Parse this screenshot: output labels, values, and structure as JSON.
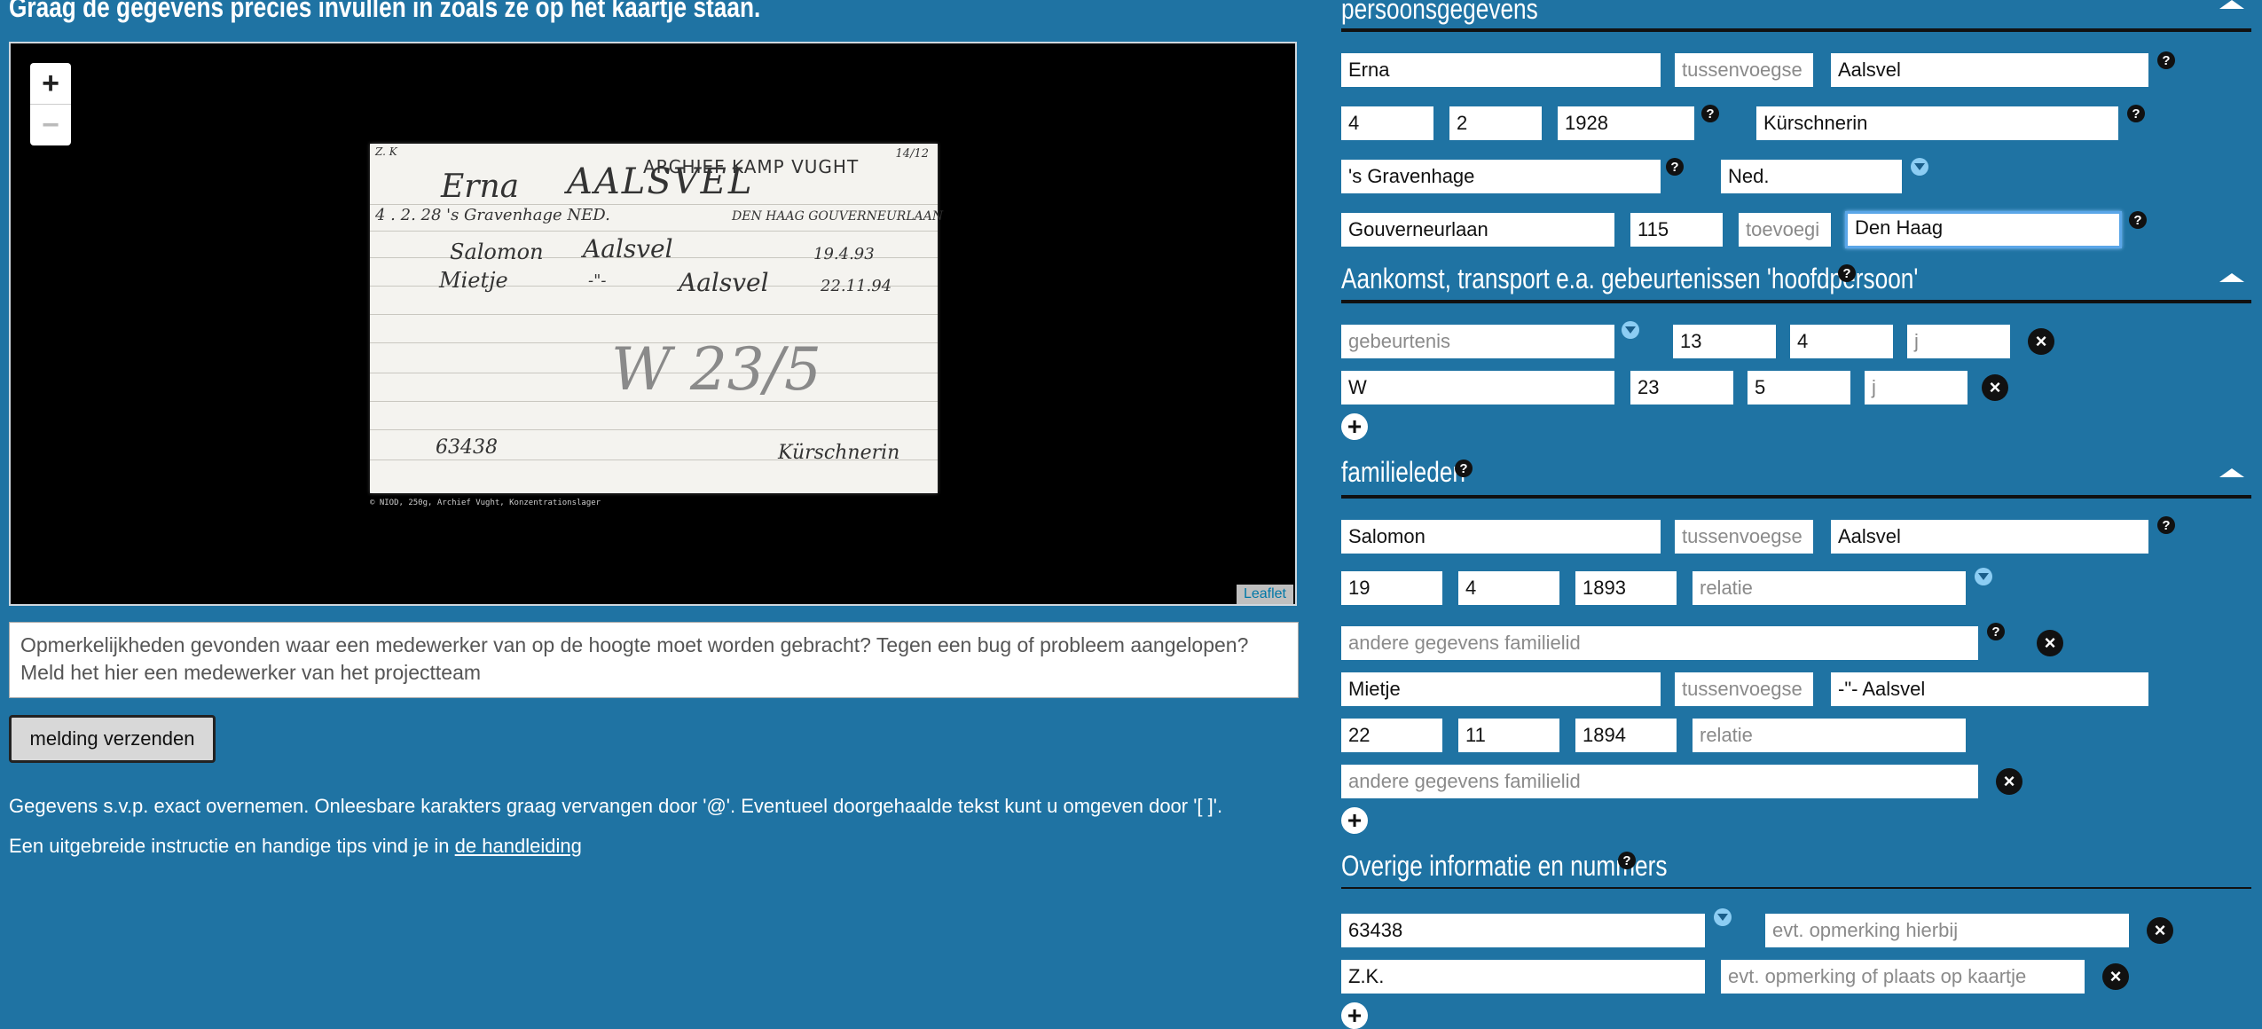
{
  "left": {
    "title": "Graag de gegevens precies invullen in zoals ze op het kaartje staan.",
    "map": {
      "zoom_in": "+",
      "zoom_out": "−",
      "attribution": "Leaflet",
      "card": {
        "corner_top_left": "Z. K",
        "corner_top_right": "14/12",
        "header": "ARCHIEF KAMP VUGHT",
        "first_name": "Erna",
        "last_name": "AALSVEL",
        "line2": "4 . 2. 28  's Gravenhage  NED.",
        "line2_right": "DEN HAAG GOUVERNEURLAAN",
        "rel1_first": "Salomon",
        "rel1_last": "Aalsvel",
        "rel1_date": "19.4.93",
        "rel2_first": "Mietje",
        "rel2_ditto": "-\"-",
        "rel2_last": "Aalsvel",
        "rel2_date": "22.11.94",
        "stamp": "W 23/5",
        "number": "63438",
        "occupation": "Kürschnerin",
        "copyright": "© NIOD, 250g, Archief Vught, Konzentrationslager"
      }
    },
    "remarks_placeholder": "Opmerkelijkheden gevonden waar een medewerker van op de hoogte moet worden gebracht? Tegen een bug of probleem aangelopen? Meld het hier een medewerker van het projectteam",
    "send_button": "melding verzenden",
    "instruction1": "Gegevens s.v.p. exact overnemen. Onleesbare karakters graag vervangen door '@'. Eventueel doorgehaalde tekst kunt u omgeven door '[ ]'.",
    "instruction2_prefix": "Een uitgebreide instructie en handige tips vind je in ",
    "instruction2_link": "de handleiding"
  },
  "right": {
    "persons": {
      "title": "persoonsgegevens",
      "first_name": "Erna",
      "infix_placeholder": "tussenvoegse",
      "last_name": "Aalsvel",
      "day": "4",
      "month": "2",
      "year": "1928",
      "occupation": "Kürschnerin",
      "birthplace": "'s Gravenhage",
      "nationality": "Ned.",
      "street": "Gouverneurlaan",
      "house_number": "115",
      "addition_placeholder": "toevoegi",
      "city": "Den Haag"
    },
    "arrival": {
      "title": "Aankomst, transport e.a. gebeurtenissen 'hoofdpersoon'",
      "rows": [
        {
          "event": "",
          "event_placeholder": "gebeurtenis",
          "day": "13",
          "month": "4",
          "year": "",
          "year_placeholder": "j"
        },
        {
          "event": "W",
          "event_placeholder": "",
          "day": "23",
          "month": "5",
          "year": "",
          "year_placeholder": "j"
        }
      ]
    },
    "family": {
      "title": "familieleden",
      "infix_placeholder": "tussenvoegse",
      "relation_placeholder": "relatie",
      "other_placeholder": "andere gegevens familielid",
      "members": [
        {
          "first": "Salomon",
          "last": "Aalsvel",
          "day": "19",
          "month": "4",
          "year": "1893"
        },
        {
          "first": "Mietje",
          "last": "-\"- Aalsvel",
          "day": "22",
          "month": "11",
          "year": "1894"
        }
      ]
    },
    "other": {
      "title": "Overige informatie en nummers",
      "rows": [
        {
          "value": "63438",
          "remark_placeholder": "evt. opmerking hierbij"
        },
        {
          "value": "Z.K.",
          "remark_placeholder": "evt. opmerking of plaats op kaartje"
        }
      ]
    },
    "help_glyph": "?",
    "remove_glyph": "×",
    "add_glyph": "+"
  }
}
